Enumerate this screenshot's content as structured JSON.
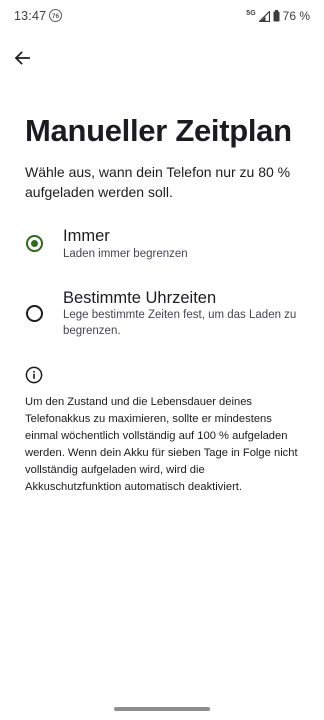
{
  "status_bar": {
    "time": "13:47",
    "notification_badge": "76",
    "network": "5G",
    "battery_percent": "76 %"
  },
  "header": {
    "back_icon": "arrow-back-icon"
  },
  "page": {
    "title": "Manueller Zeitplan",
    "description": "Wähle aus, wann dein Telefon nur zu 80 % aufgeladen werden soll."
  },
  "options": [
    {
      "title": "Immer",
      "subtitle": "Laden immer begrenzen",
      "selected": true
    },
    {
      "title": "Bestimmte Uhrzeiten",
      "subtitle": "Lege bestimmte Zeiten fest, um das Laden zu begrenzen.",
      "selected": false
    }
  ],
  "info": {
    "icon": "info-icon",
    "text": "Um den Zustand und die Lebensdauer deines Telefonakkus zu maximieren, sollte er mindestens einmal wöchentlich vollständig auf 100 % aufgeladen werden. Wenn dein Akku für sieben Tage in Folge nicht vollständig aufgeladen wird, wird die Akkuschutzfunktion automatisch deaktiviert."
  },
  "colors": {
    "accent": "#2e6a1c",
    "text_primary": "#1c1b1f",
    "text_secondary": "#45464f",
    "background": "#ffffff"
  }
}
